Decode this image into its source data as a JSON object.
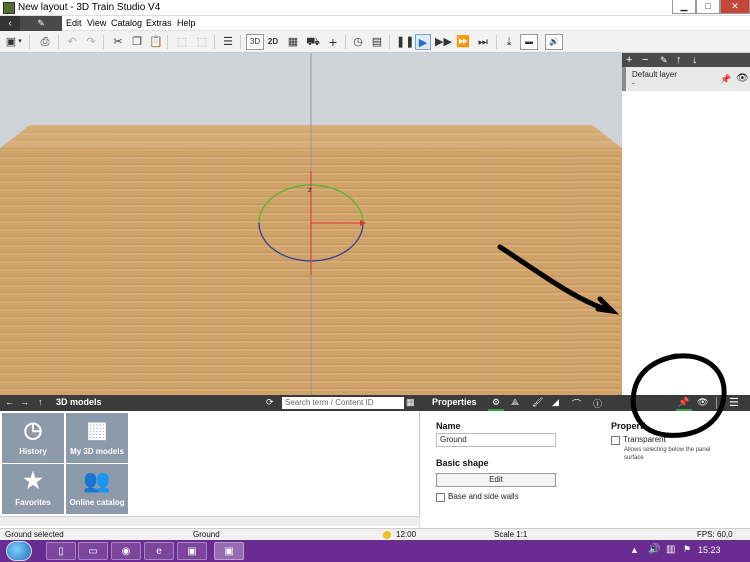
{
  "window": {
    "title": "New layout - 3D Train Studio V4",
    "controls": {
      "minimize": "▁",
      "maximize": "□",
      "close": "✕"
    }
  },
  "menubar": {
    "back_icon": "‹",
    "pen_icon": "✎",
    "items": [
      "Edit",
      "View",
      "Catalog",
      "Extras",
      "Help"
    ]
  },
  "toolbar": {
    "view_3d": "3D",
    "view_2d": "2D"
  },
  "layers_panel": {
    "layer_name": "Default layer",
    "layer_sub": "-"
  },
  "catalog_panel": {
    "title": "3D models",
    "search_placeholder": "Search term / Content ID",
    "tiles": [
      {
        "label": "History",
        "icon": "clock-icon"
      },
      {
        "label": "My 3D models",
        "icon": "grid-icon"
      },
      {
        "label": "Favorites",
        "icon": "star-icon"
      },
      {
        "label": "Online catalog",
        "icon": "people-icon"
      }
    ]
  },
  "properties_panel": {
    "title": "Properties",
    "name_label": "Name",
    "name_value": "Ground",
    "basic_shape_label": "Basic shape",
    "edit_button": "Edit",
    "base_walls_label": "Base and side walls",
    "right_heading": "Properti",
    "transparent_label": "Transparent",
    "transparent_hint": "Allows selecting below the panel surface"
  },
  "statusbar": {
    "selection": "Ground selected",
    "object": "Ground",
    "time": "12:00",
    "scale": "Scale 1:1",
    "fps": "FPS: 60,0"
  },
  "taskbar": {
    "clock": "15:23"
  },
  "colors": {
    "accent_green": "#3aa34a",
    "dark_panel": "#3b3b3b",
    "taskbar": "#6b2c91",
    "annotation": "#000000"
  }
}
